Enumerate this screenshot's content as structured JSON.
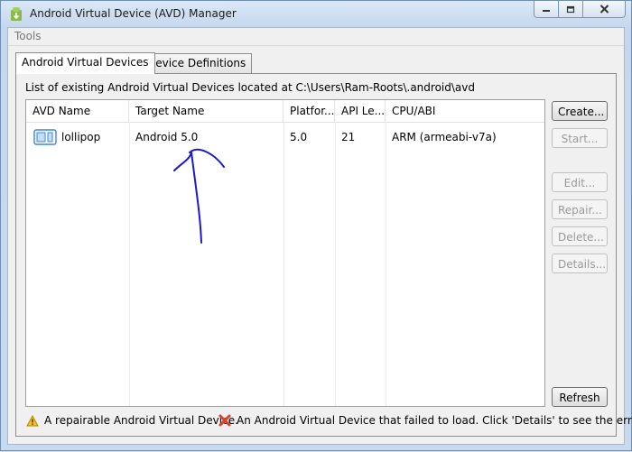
{
  "window": {
    "title": "Android Virtual Device (AVD) Manager",
    "controls": [
      "minimize-icon",
      "maximize-icon",
      "close-icon"
    ]
  },
  "menu": {
    "tools": "Tools"
  },
  "tabs": [
    {
      "label": "Android Virtual Devices",
      "active": true
    },
    {
      "label": "Device Definitions",
      "active": false
    }
  ],
  "panel": {
    "location_label": "List of existing Android Virtual Devices located at C:\\Users\\Ram-Roots\\.android\\avd"
  },
  "table": {
    "columns": [
      "AVD Name",
      "Target Name",
      "Platfor...",
      "API Le...",
      "CPU/ABI"
    ],
    "rows": [
      {
        "avd_name": "lollipop",
        "target_name": "Android 5.0",
        "platform": "5.0",
        "api_level": "21",
        "cpu_abi": "ARM (armeabi-v7a)",
        "icon": "device-icon"
      }
    ]
  },
  "buttons": {
    "create": "Create...",
    "start": "Start...",
    "edit": "Edit...",
    "repair": "Repair...",
    "delete": "Delete...",
    "details": "Details...",
    "refresh": "Refresh"
  },
  "legend": {
    "repairable": "A repairable Android Virtual Device.",
    "failed": "An Android Virtual Device that failed to load. Click 'Details' to see the error.",
    "repairable_icon": "warning-icon",
    "failed_icon": "error-x-icon"
  },
  "colors": {
    "annotation": "#1a1acc",
    "warning": "#e8b400",
    "error": "#d8432c",
    "device_icon": "#3f86d8"
  }
}
